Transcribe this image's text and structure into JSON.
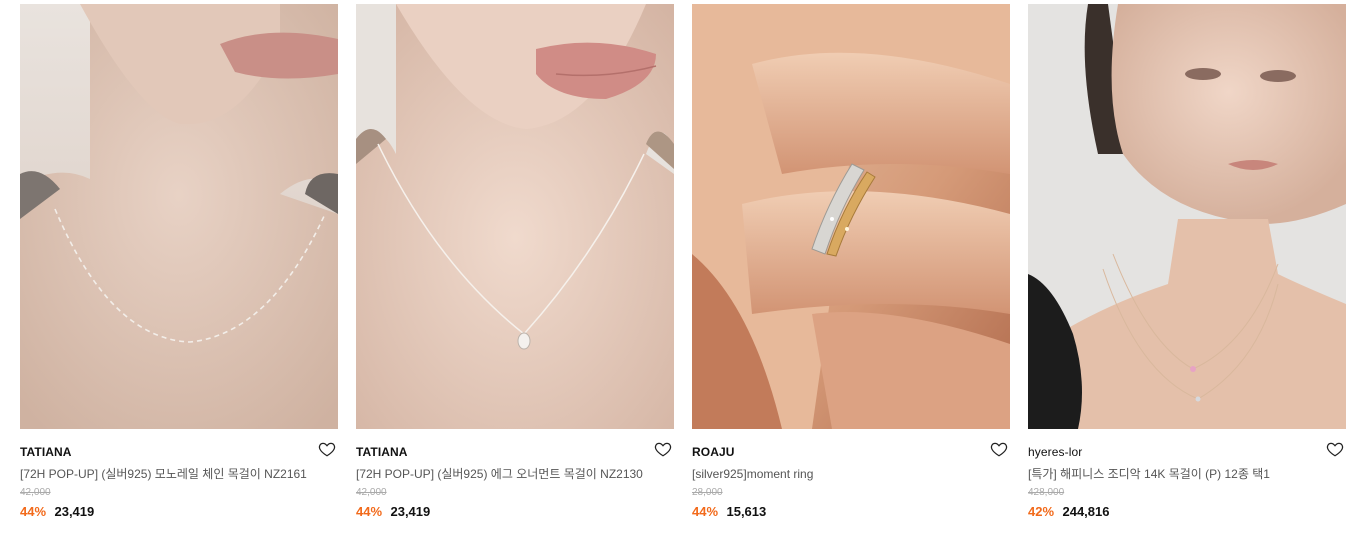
{
  "products": [
    {
      "brand": "TATIANA",
      "title": "[72H POP-UP] (실버925) 모노레일 체인 목걸이 NZ2161",
      "original_price": "42,000",
      "discount": "44%",
      "price": "23,419",
      "image_alt": "neck-chain-photo",
      "icon": "heart-icon"
    },
    {
      "brand": "TATIANA",
      "title": "[72H POP-UP] (실버925) 에그 오너먼트 목걸이 NZ2130",
      "original_price": "42,000",
      "discount": "44%",
      "price": "23,419",
      "image_alt": "egg-pendant-photo",
      "icon": "heart-icon"
    },
    {
      "brand": "ROAJU",
      "title": "[silver925]moment ring",
      "original_price": "28,000",
      "discount": "44%",
      "price": "15,613",
      "image_alt": "ring-on-finger-photo",
      "icon": "heart-icon"
    },
    {
      "brand": "hyeres-lor",
      "title": "[특가] 해피니스 조디악 14K 목걸이 (P) 12종 택1",
      "original_price": "428,000",
      "discount": "42%",
      "price": "244,816",
      "image_alt": "model-necklace-photo",
      "icon": "heart-icon"
    }
  ],
  "colors": {
    "discount": "#f26a1b",
    "brand": "#111111",
    "title": "#555555",
    "original_price": "#aaaaaa"
  }
}
